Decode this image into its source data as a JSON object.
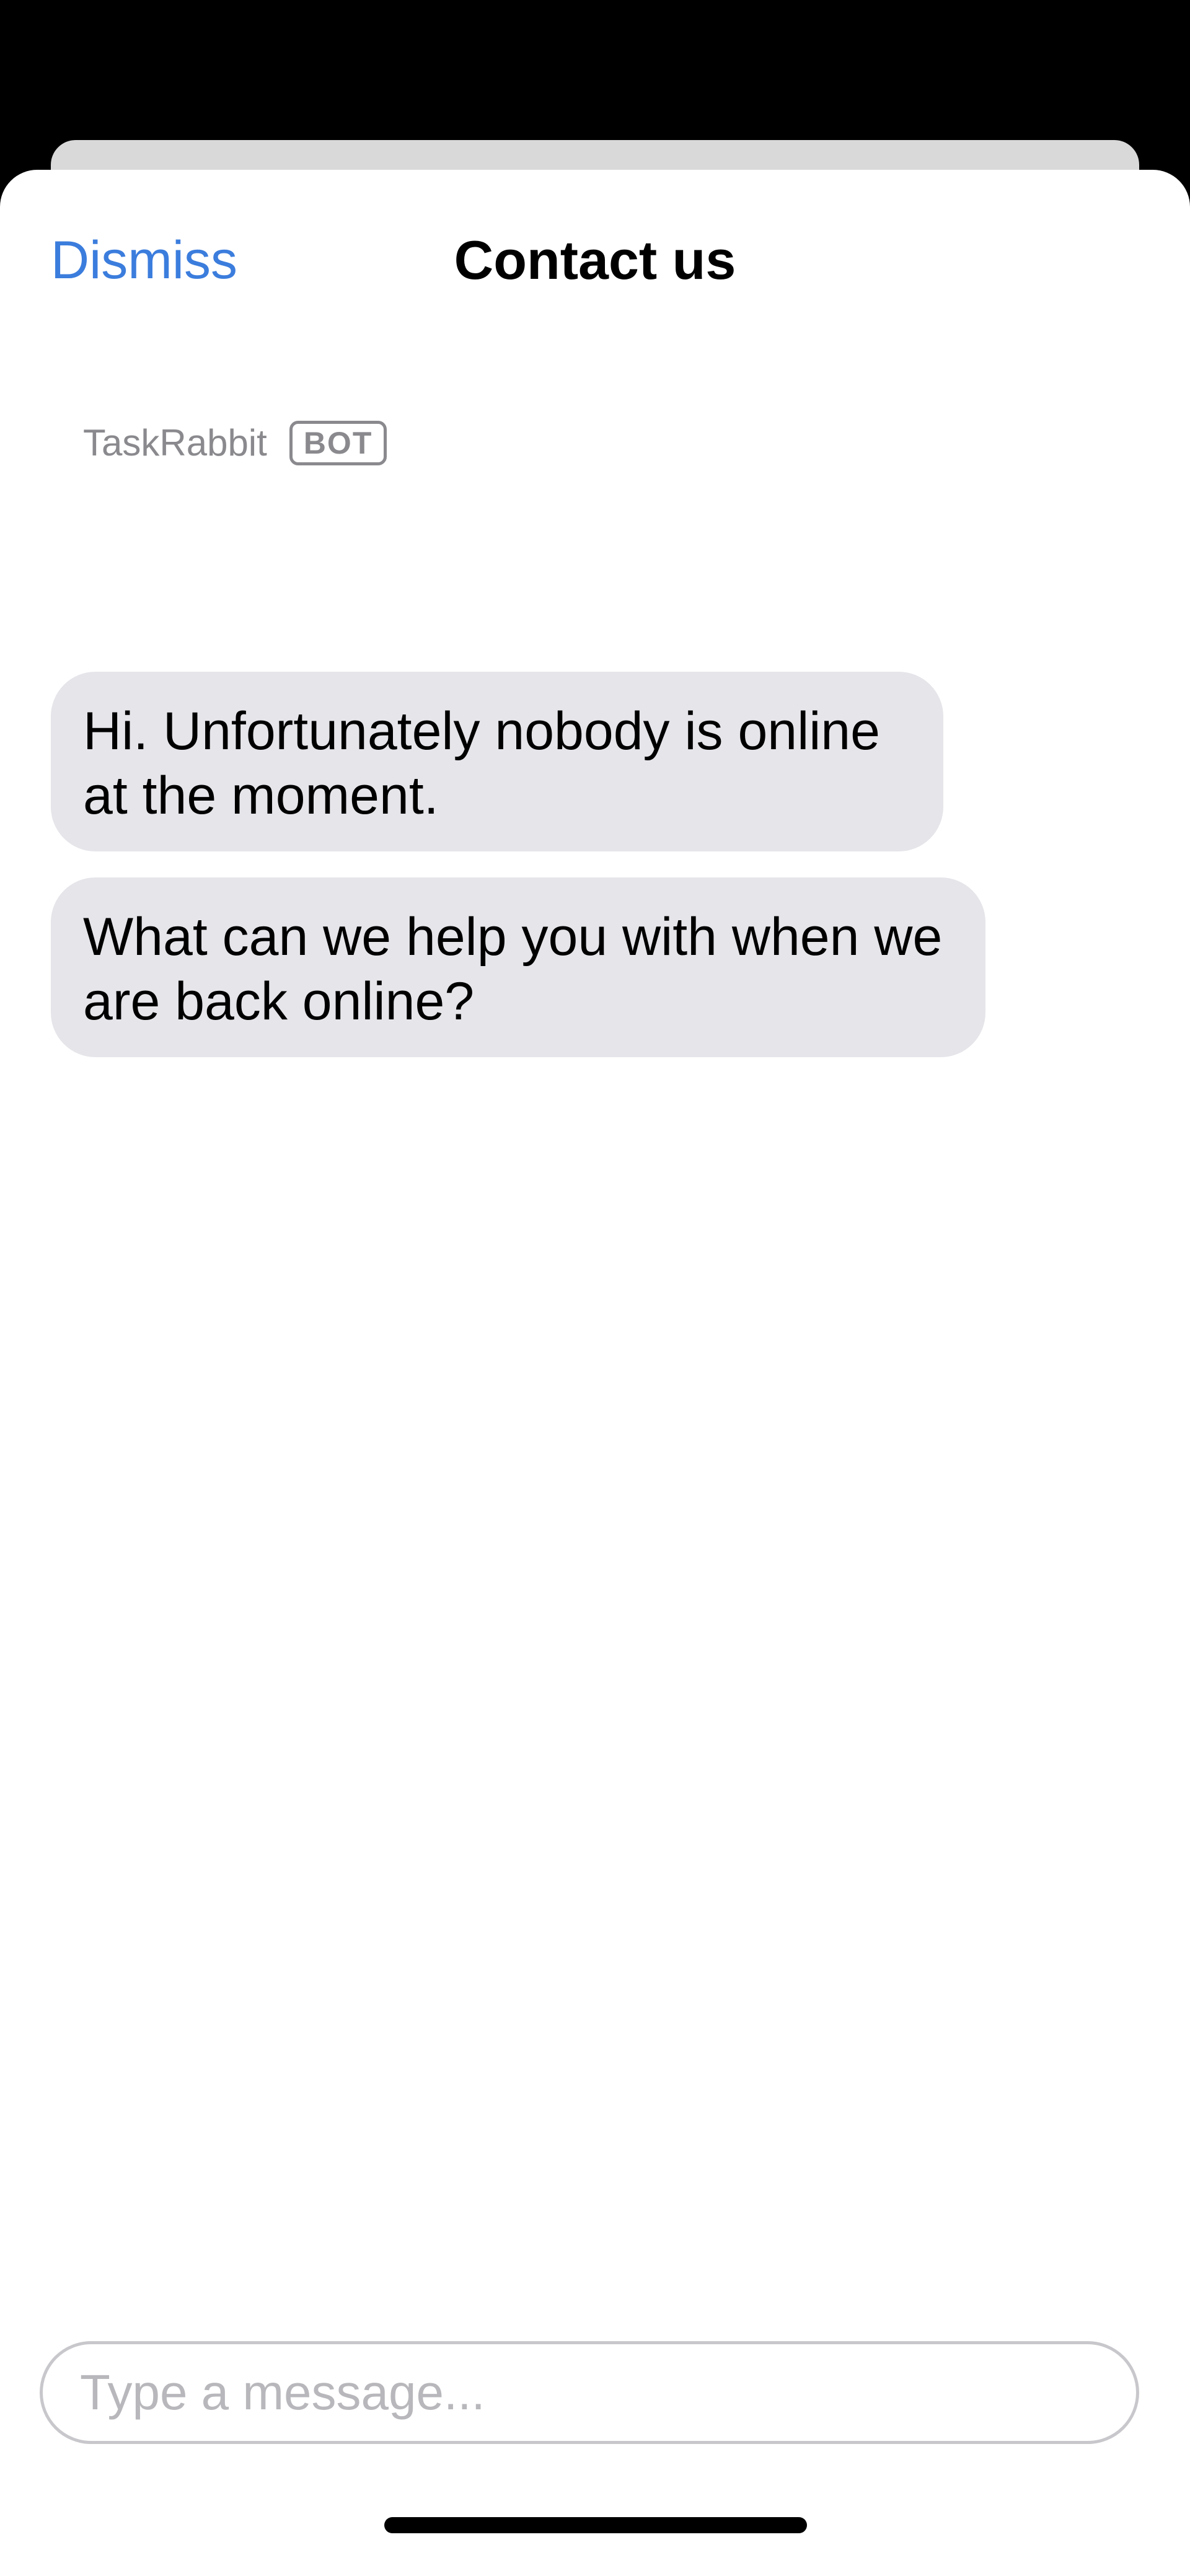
{
  "header": {
    "dismiss_label": "Dismiss",
    "title": "Contact us"
  },
  "thread": {
    "sender_name": "TaskRabbit",
    "sender_badge": "BOT",
    "messages": [
      {
        "text": "Hi. Unfortunately nobody is online at the moment."
      },
      {
        "text": "What can we help you with when we are back online?"
      }
    ]
  },
  "composer": {
    "placeholder": "Type a message...",
    "value": ""
  },
  "colors": {
    "accent": "#3b7ddd",
    "bubble_background": "#e5e5ea",
    "secondary_text": "#8a8a8e",
    "backdrop": "#000000"
  }
}
